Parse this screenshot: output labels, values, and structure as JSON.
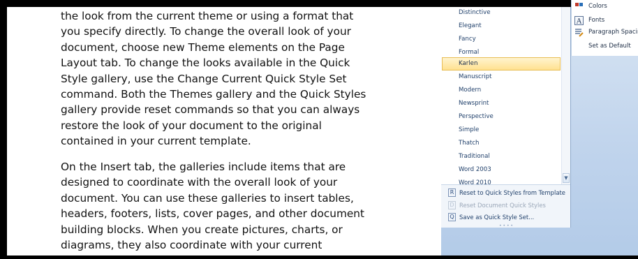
{
  "document": {
    "paragraph1": [
      "the look from the current theme or using a format that",
      "you specify directly. To change the overall look of your",
      "document, choose new Theme elements on the Page",
      "Layout tab. To change the looks available in the Quick",
      "Style gallery, use the Change Current Quick Style Set",
      "command. Both the Themes gallery and the Quick Styles",
      "gallery provide reset commands so that you can always",
      "restore the look of your document to the original",
      "contained in your current template."
    ],
    "paragraph2": [
      "On the Insert tab, the galleries include items that are",
      "designed to coordinate with the overall look of your",
      "document. You can use these galleries to insert tables,",
      "headers, footers, lists, cover pages, and other document",
      "building blocks. When you create pictures, charts, or",
      "diagrams, they also coordinate with your current"
    ]
  },
  "style_sets": {
    "items": [
      "Distinctive",
      "Elegant",
      "Fancy",
      "Formal",
      "Karlen",
      "Manuscript",
      "Modern",
      "Newsprint",
      "Perspective",
      "Simple",
      "Thatch",
      "Traditional",
      "Word 2003",
      "Word 2010"
    ],
    "selected": "Karlen",
    "footer": [
      {
        "label": "Reset to Quick Styles from Template",
        "icon": "R",
        "enabled": true
      },
      {
        "label": "Reset Document Quick Styles",
        "icon": "D",
        "enabled": false
      },
      {
        "label": "Save as Quick Style Set...",
        "icon": "Q",
        "enabled": true
      }
    ]
  },
  "change_styles": {
    "items": [
      {
        "label": "Colors",
        "icon": "colors-icon"
      },
      {
        "label": "Fonts",
        "icon": "fonts-icon"
      },
      {
        "label": "Paragraph Spacing",
        "icon": "paragraph-spacing-icon"
      },
      {
        "label": "Set as Default",
        "icon": ""
      }
    ]
  },
  "colors": {
    "highlight": "#ffe190",
    "highlight_border": "#e8bd55",
    "menu_text": "#1f3f6a",
    "workspace": "#bfd3ec"
  }
}
